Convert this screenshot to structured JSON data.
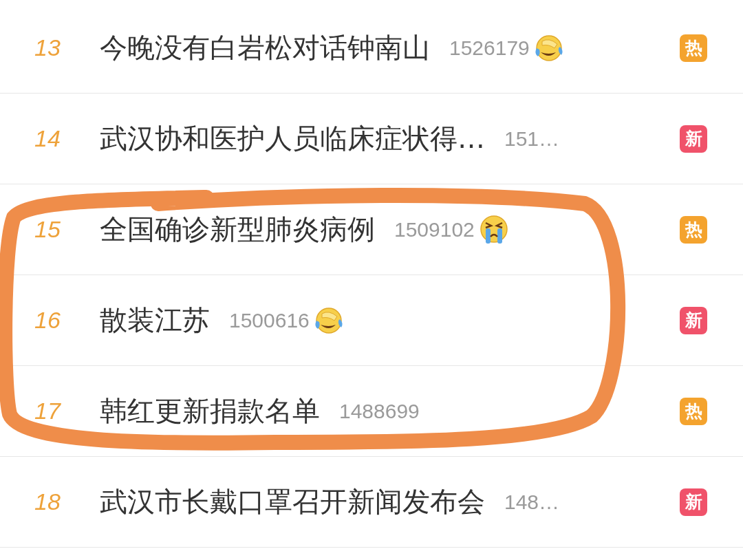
{
  "hot_search": [
    {
      "rank": "13",
      "title": "今晚没有白岩松对话钟南山",
      "count": "1526179",
      "emoji": {
        "kind": "laughing-crying"
      },
      "badge": {
        "text": "热",
        "kind": "hot"
      }
    },
    {
      "rank": "14",
      "title": "武汉协和医护人员临床症状得…",
      "count": "151…",
      "badge": {
        "text": "新",
        "kind": "new"
      }
    },
    {
      "rank": "15",
      "title": "全国确诊新型肺炎病例",
      "count": "1509102",
      "emoji": {
        "kind": "crying"
      },
      "badge": {
        "text": "热",
        "kind": "hot"
      }
    },
    {
      "rank": "16",
      "title": "散装江苏",
      "count": "1500616",
      "emoji": {
        "kind": "laughing-crying"
      },
      "badge": {
        "text": "新",
        "kind": "new"
      }
    },
    {
      "rank": "17",
      "title": "韩红更新捐款名单",
      "count": "1488699",
      "badge": {
        "text": "热",
        "kind": "hot"
      }
    },
    {
      "rank": "18",
      "title": "武汉市长戴口罩召开新闻发布会",
      "count": "148…",
      "badge": {
        "text": "新",
        "kind": "new"
      }
    }
  ]
}
